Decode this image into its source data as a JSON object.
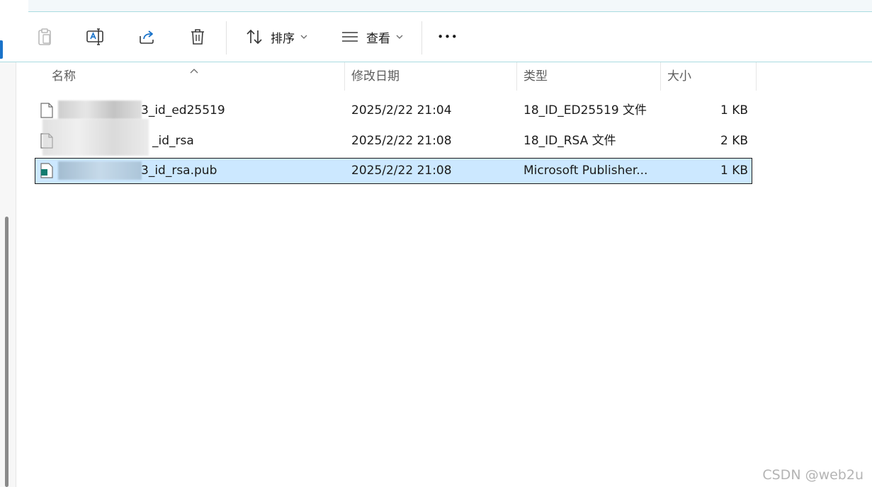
{
  "toolbar": {
    "sort_label": "排序",
    "view_label": "查看",
    "more_label": "•••"
  },
  "columns": {
    "name": "名称",
    "date": "修改日期",
    "type": "类型",
    "size": "大小"
  },
  "files": [
    {
      "name": "3_id_ed25519",
      "date": "2025/2/22 21:04",
      "type": "18_ID_ED25519 文件",
      "size": "1 KB",
      "selected": false
    },
    {
      "name": "_id_rsa",
      "date": "2025/2/22 21:08",
      "type": "18_ID_RSA 文件",
      "size": "2 KB",
      "selected": false
    },
    {
      "name": "3_id_rsa.pub",
      "date": "2025/2/22 21:08",
      "type": "Microsoft Publisher...",
      "size": "1 KB",
      "selected": true
    }
  ],
  "watermark": "CSDN @web2u",
  "colors": {
    "accent": "#1a73c9",
    "selection": "#cce8ff",
    "border": "#a9dbe1"
  },
  "icons": [
    "paste-icon",
    "rename-icon",
    "share-icon",
    "delete-icon",
    "sort-icon",
    "view-icon",
    "more-icon",
    "file-icon"
  ]
}
